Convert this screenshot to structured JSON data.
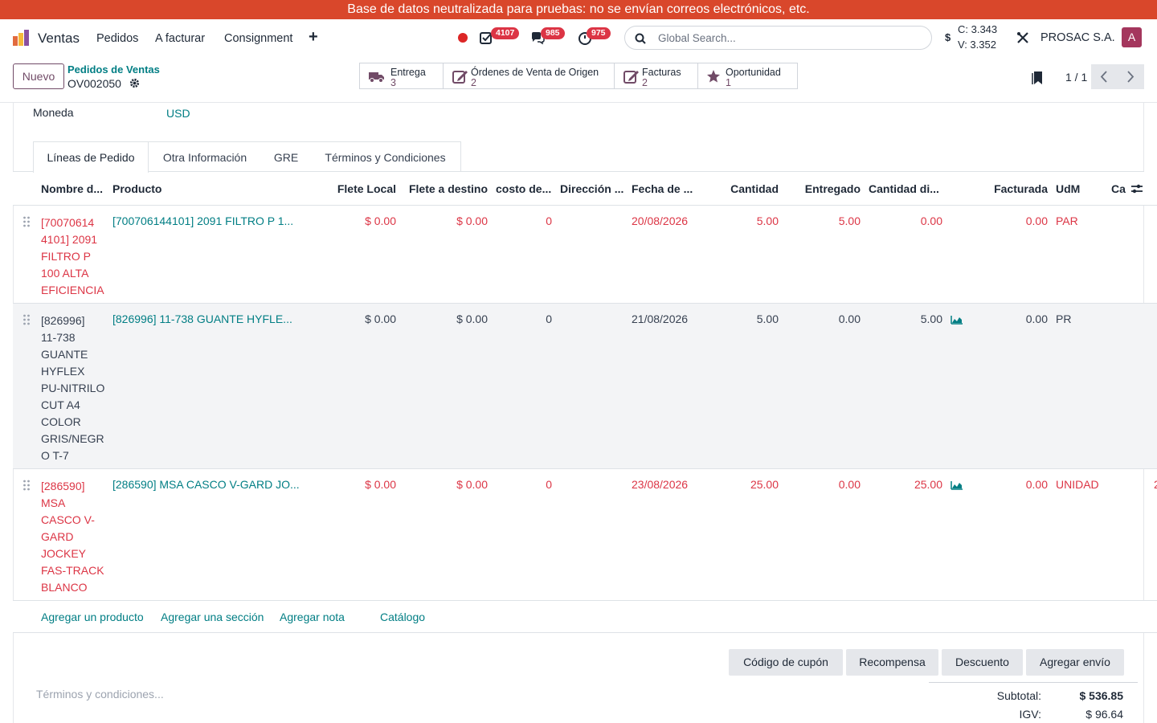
{
  "banner": {
    "text": "Base de datos neutralizada para pruebas: no se envían correos electrónicos, etc."
  },
  "navbar": {
    "app_name": "Ventas",
    "menu": [
      "Pedidos",
      "A facturar",
      "Consignment"
    ],
    "plus": "+",
    "badges": {
      "activities": "4107",
      "messages": "985",
      "timers": "975"
    },
    "search_placeholder": "Global Search...",
    "currency_sign": "$",
    "rate_c": "C: 3.343",
    "rate_v": "V: 3.352",
    "company": "PROSAC S.A.",
    "avatar_letter": "A",
    "colors": {
      "brand": "#714b67",
      "badge": "#dc3545",
      "banner": "#d9472b"
    }
  },
  "control": {
    "new_label": "Nuevo",
    "breadcrumb_parent": "Pedidos de Ventas",
    "breadcrumb_current": "OV002050",
    "smart_buttons": [
      {
        "label": "Entrega",
        "count": "3",
        "icon": "truck-icon"
      },
      {
        "label": "Órdenes de Venta de Origen",
        "count": "2",
        "icon": "edit-icon"
      },
      {
        "label": "Facturas",
        "count": "2",
        "icon": "invoice-edit-icon"
      },
      {
        "label": "Oportunidad",
        "count": "1",
        "icon": "star-icon"
      }
    ],
    "pager": "1 / 1"
  },
  "form": {
    "currency_label": "Moneda",
    "currency_value": "USD"
  },
  "tabs": [
    "Líneas de Pedido",
    "Otra Información",
    "GRE",
    "Términos y Condiciones"
  ],
  "table": {
    "headers": {
      "name": "Nombre d...",
      "product": "Producto",
      "flete_local": "Flete Local",
      "flete_destino": "Flete a destino",
      "costo": "costo de...",
      "direccion": "Dirección ...",
      "fecha": "Fecha de ...",
      "cantidad": "Cantidad",
      "entregado": "Entregado",
      "cantidad_di": "Cantidad di...",
      "facturada": "Facturada",
      "udm": "UdM",
      "ca": "Ca"
    },
    "rows": [
      {
        "name": "[700706144101] 2091 FILTRO P 100 ALTA EFICIENCIA",
        "product": "[700706144101] 2091 FILTRO P 1...",
        "flete_local": "$ 0.00",
        "flete_destino": "$ 0.00",
        "costo": "0",
        "fecha": "20/08/2026",
        "cantidad": "5.00",
        "entregado": "5.00",
        "cantidad_di": "0.00",
        "facturada": "0.00",
        "udm": "PAR",
        "extra": "",
        "status": "red",
        "forecast": false
      },
      {
        "name": "[826996] 11-738 GUANTE HYFLEX PU-NITRILO CUT A4 COLOR GRIS/NEGRO T-7",
        "product": "[826996] 11-738 GUANTE HYFLE...",
        "flete_local": "$ 0.00",
        "flete_destino": "$ 0.00",
        "costo": "0",
        "fecha": "21/08/2026",
        "cantidad": "5.00",
        "entregado": "0.00",
        "cantidad_di": "5.00",
        "facturada": "0.00",
        "udm": "PR",
        "extra": "",
        "status": "dark",
        "forecast": true
      },
      {
        "name": "[286590] MSA CASCO V-GARD JOCKEY FAS-TRACK BLANCO",
        "product": "[286590] MSA CASCO V-GARD JO...",
        "flete_local": "$ 0.00",
        "flete_destino": "$ 0.00",
        "costo": "0",
        "fecha": "23/08/2026",
        "cantidad": "25.00",
        "entregado": "0.00",
        "cantidad_di": "25.00",
        "facturada": "0.00",
        "udm": "UNIDAD",
        "extra": "2",
        "status": "red",
        "forecast": true
      }
    ],
    "row_name_lines": [
      [
        "[70070614",
        "4101] 2091",
        "FILTRO P",
        "100 ALTA",
        "EFICIENCIA"
      ],
      [
        "[826996]",
        "11-738",
        "GUANTE",
        "HYFLEX",
        "PU-NITRILO",
        "CUT A4",
        "COLOR",
        "GRIS/NEGR",
        "O T-7"
      ],
      [
        "[286590]",
        "MSA",
        "CASCO V-",
        "GARD",
        "JOCKEY",
        "FAS-TRACK",
        "BLANCO"
      ]
    ]
  },
  "add_links": [
    "Agregar un producto",
    "Agregar una sección",
    "Agregar nota",
    "Catálogo"
  ],
  "promo_buttons": [
    "Código de cupón",
    "Recompensa",
    "Descuento",
    "Agregar envío"
  ],
  "terms_placeholder": "Términos y condiciones...",
  "totals": {
    "subtotal_label": "Subtotal:",
    "subtotal_value": "$ 536.85",
    "igv_label": "IGV:",
    "igv_value": "$ 96.64"
  }
}
